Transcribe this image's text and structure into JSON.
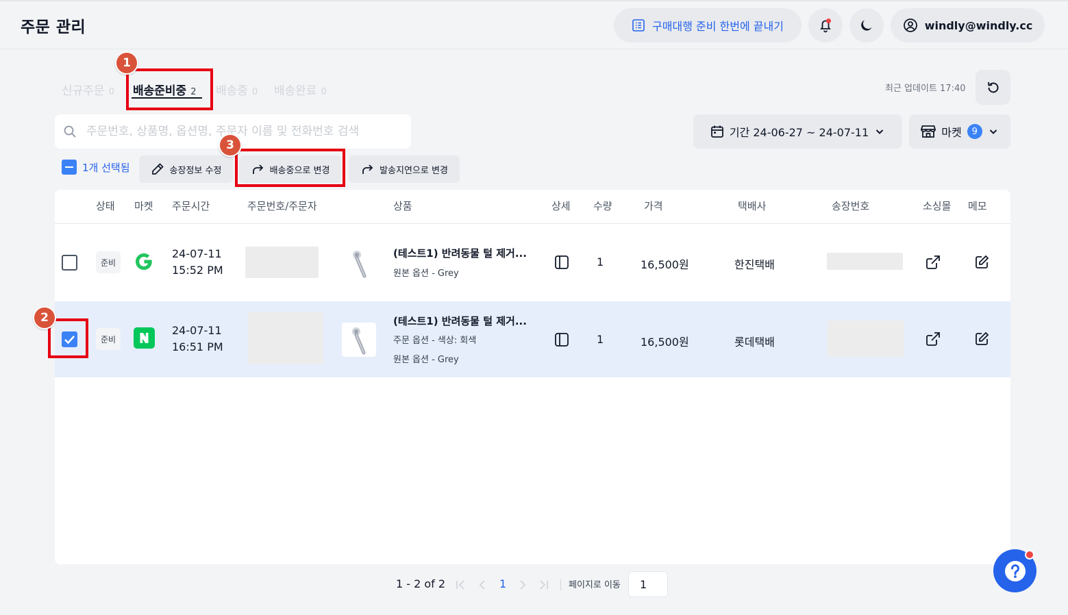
{
  "header": {
    "title": "주문 관리",
    "promo_label": "구매대행 준비 한번에 끝내기",
    "account_email": "windly@windly.cc"
  },
  "tabs": [
    {
      "label": "신규주문",
      "count": "0"
    },
    {
      "label": "배송준비중",
      "count": "2"
    },
    {
      "label": "배송중",
      "count": "0"
    },
    {
      "label": "배송완료",
      "count": "0"
    }
  ],
  "last_updated": "최근 업데이트 17:40",
  "search": {
    "placeholder": "주문번호, 상품명, 옵션명, 주문자 이름 및 전화번호 검색"
  },
  "filters": {
    "period_label": "기간 24-06-27 ~ 24-07-11",
    "market_label": "마켓",
    "market_count": "9"
  },
  "toolbar": {
    "selected_label": "1개 선택됨",
    "edit_invoice_label": "송장정보 수정",
    "to_shipping_label": "배송중으로 변경",
    "to_delay_label": "발송지연으로 변경"
  },
  "table": {
    "columns": [
      "상태",
      "마켓",
      "주문시간",
      "주문번호/주문자",
      "상품",
      "상세",
      "수량",
      "가격",
      "택배사",
      "송장번호",
      "소싱몰",
      "메모"
    ],
    "rows": [
      {
        "status": "준비",
        "market": "G",
        "date": "24-07-11",
        "time": "15:52 PM",
        "product_title": "(테스트1) 반려동물 털 제거...",
        "options": [
          "원본 옵션 - Grey"
        ],
        "qty": "1",
        "price": "16,500원",
        "courier": "한진택배",
        "checked": false
      },
      {
        "status": "준비",
        "market": "N",
        "date": "24-07-11",
        "time": "16:51 PM",
        "product_title": "(테스트1) 반려동물 털 제거...",
        "options": [
          "주문 옵션 - 색상: 회색",
          "원본 옵션 - Grey"
        ],
        "qty": "1",
        "price": "16,500원",
        "courier": "롯데택배",
        "checked": true
      }
    ]
  },
  "pagination": {
    "range": "1 - 2 of 2",
    "current_page": "1",
    "goto_label": "페이지로 이동",
    "goto_value": "1"
  },
  "annotations": [
    "1",
    "2",
    "3"
  ],
  "colors": {
    "accent": "#2563eb",
    "highlight": "#e60012",
    "badge": "#d9533a",
    "gmarket_green": "#22c55e",
    "naver_green": "#03c75a"
  }
}
